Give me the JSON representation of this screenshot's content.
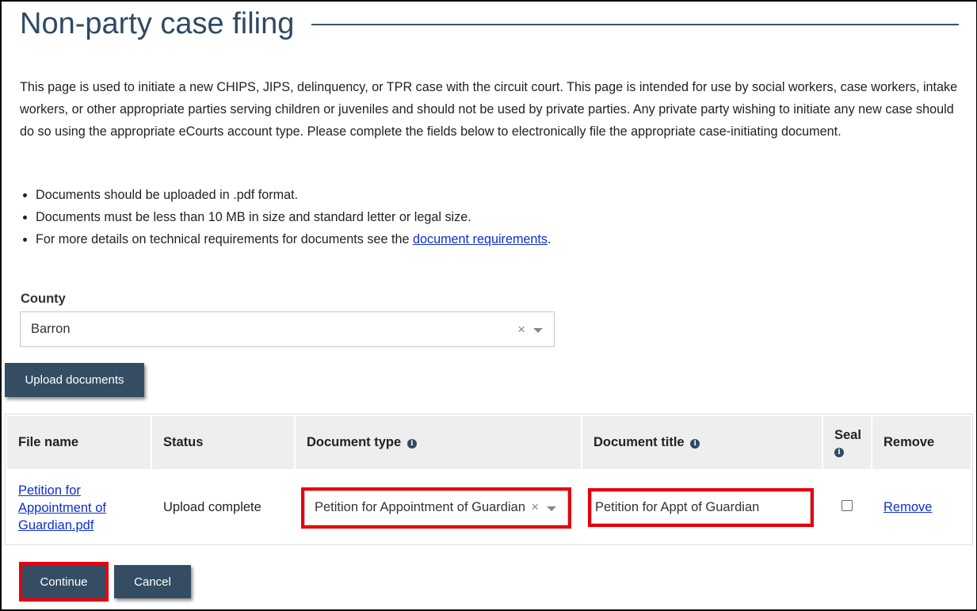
{
  "page": {
    "title": "Non-party case filing",
    "intro": "This page is used to initiate a new CHIPS, JIPS, delinquency, or TPR case with the circuit court. This page is intended for use by social workers, case workers, intake workers, or other appropriate parties serving children or juveniles and should not be used by private parties. Any private party wishing to initiate any new case should do so using the appropriate eCourts account type. Please complete the fields below to electronically file the appropriate case-initiating document.",
    "bullets": [
      "Documents should be uploaded in .pdf format.",
      "Documents must be less than 10 MB in size and standard letter or legal size.",
      "For more details on technical requirements for documents see the "
    ],
    "bullet_link": "document requirements",
    "bullet_suffix": "."
  },
  "county": {
    "label": "County",
    "value": "Barron",
    "clear_icon": "×"
  },
  "upload_button": "Upload documents",
  "table": {
    "headers": {
      "file_name": "File name",
      "status": "Status",
      "document_type": "Document type",
      "document_title": "Document title",
      "seal": "Seal",
      "remove": "Remove"
    },
    "info_icon": "i",
    "rows": [
      {
        "file_name": "Petition for Appointment of Guardian.pdf",
        "status": "Upload complete",
        "document_type": "Petition for Appointment of Guardian",
        "document_title": "Petition for Appt of Guardian",
        "seal_checked": false,
        "remove_label": "Remove"
      }
    ]
  },
  "actions": {
    "continue": "Continue",
    "cancel": "Cancel"
  },
  "colors": {
    "primary": "#344d63",
    "highlight": "#e8000b",
    "link": "#0b2fd1"
  }
}
